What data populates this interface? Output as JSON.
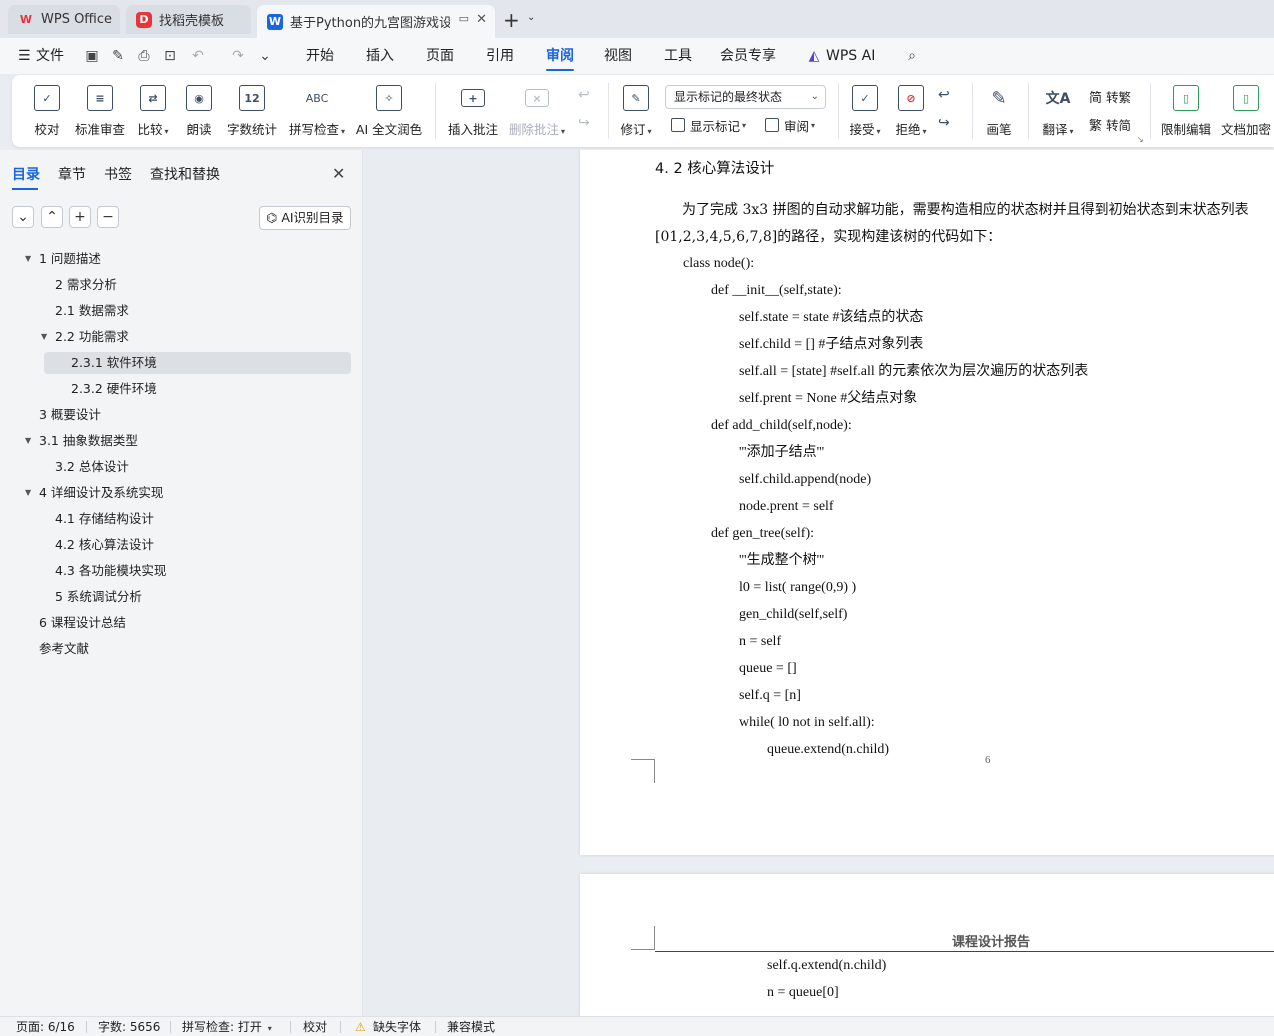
{
  "tabs": [
    {
      "label": "WPS Office",
      "logo": "W"
    },
    {
      "label": "找稻壳模板",
      "logo": "D"
    },
    {
      "label": "基于Python的九宫图游戏设计",
      "logo": "W"
    }
  ],
  "menu": {
    "file": "文件",
    "items": [
      "开始",
      "插入",
      "页面",
      "引用",
      "审阅",
      "视图",
      "工具",
      "会员专享"
    ],
    "active": "审阅",
    "wps_ai": "WPS AI"
  },
  "ribbon": {
    "proofread": "校对",
    "standard_review": "标准审查",
    "compare": "比较",
    "read_aloud": "朗读",
    "word_count": "字数统计",
    "spell_check": "拼写检查",
    "ai_polish": "AI 全文润色",
    "insert_comment": "插入批注",
    "delete_comment": "删除批注",
    "revise": "修订",
    "display_select": "显示标记的最终状态",
    "show_markup": "显示标记",
    "review": "审阅",
    "accept": "接受",
    "reject": "拒绝",
    "pen": "画笔",
    "translate": "翻译",
    "to_traditional": "转繁",
    "to_simplified": "转简",
    "restrict_edit": "限制编辑",
    "doc_encrypt": "文档加密",
    "icons": {
      "abc": "ABC",
      "twelve": "12"
    }
  },
  "nav": {
    "tabs": [
      "目录",
      "章节",
      "书签",
      "查找和替换"
    ],
    "active_tab": "目录",
    "ai_button": "AI识别目录",
    "toc": [
      {
        "label": "1  问题描述",
        "level": 0,
        "arrow": true
      },
      {
        "label": "2  需求分析",
        "level": 1,
        "arrow": false
      },
      {
        "label": "2.1  数据需求",
        "level": 1,
        "arrow": false
      },
      {
        "label": "2.2  功能需求",
        "level": 1,
        "arrow": true
      },
      {
        "label": "2.3.1 软件环境",
        "level": 2,
        "arrow": false,
        "selected": true
      },
      {
        "label": "2.3.2 硬件环境",
        "level": 2,
        "arrow": false
      },
      {
        "label": "3  概要设计",
        "level": 0,
        "arrow": false
      },
      {
        "label": "3.1 抽象数据类型",
        "level": 0,
        "arrow": true
      },
      {
        "label": "3.2  总体设计",
        "level": 1,
        "arrow": false
      },
      {
        "label": "4  详细设计及系统实现",
        "level": 0,
        "arrow": true
      },
      {
        "label": "4.1  存储结构设计",
        "level": 1,
        "arrow": false
      },
      {
        "label": "4.2  核心算法设计",
        "level": 1,
        "arrow": false
      },
      {
        "label": "4.3  各功能模块实现",
        "level": 1,
        "arrow": false
      },
      {
        "label": "5  系统调试分析",
        "level": 1,
        "arrow": false
      },
      {
        "label": "6  课程设计总结",
        "level": 0,
        "arrow": false
      },
      {
        "label": "参考文献",
        "level": 0,
        "arrow": false
      }
    ]
  },
  "document": {
    "heading": "4. 2  核心算法设计",
    "para1": "为了完成 3x3 拼图的自动求解功能，需要构造相应的状态树并且得到初始状态到末状态列表",
    "para2": "[01,2,3,4,5,6,7,8]的路径，实现构建该树的代码如下：",
    "code": [
      {
        "indent": 0,
        "text": "class node():"
      },
      {
        "indent": 1,
        "text": "def __init__(self,state):"
      },
      {
        "indent": 2,
        "text": "self.state = state    #该结点的状态"
      },
      {
        "indent": 2,
        "text": "self.child = []         #子结点对象列表"
      },
      {
        "indent": 2,
        "text": "self.all = [state]      #self.all 的元素依次为层次遍历的状态列表"
      },
      {
        "indent": 2,
        "text": "self.prent = None      #父结点对象"
      },
      {
        "indent": 1,
        "text": "def add_child(self,node):"
      },
      {
        "indent": 2,
        "text": "'''添加子结点'''"
      },
      {
        "indent": 2,
        "text": "self.child.append(node)"
      },
      {
        "indent": 2,
        "text": "node.prent = self"
      },
      {
        "indent": 1,
        "text": "def gen_tree(self):"
      },
      {
        "indent": 2,
        "text": "'''生成整个树'''"
      },
      {
        "indent": 2,
        "text": "l0 = list( range(0,9) )"
      },
      {
        "indent": 2,
        "text": "gen_child(self,self)"
      },
      {
        "indent": 2,
        "text": "n = self"
      },
      {
        "indent": 2,
        "text": "queue = []"
      },
      {
        "indent": 2,
        "text": "self.q = [n]"
      },
      {
        "indent": 2,
        "text": "while( l0 not in self.all):"
      },
      {
        "indent": 3,
        "text": "queue.extend(n.child)"
      }
    ],
    "page_number": "6",
    "page2_header": "课程设计报告",
    "page2_code": [
      {
        "indent": 3,
        "text": "self.q.extend(n.child)"
      },
      {
        "indent": 3,
        "text": "n = queue[0]"
      }
    ]
  },
  "status": {
    "page": "页面: 6/16",
    "words": "字数: 5656",
    "spell": "拼写检查: 打开",
    "proof": "校对",
    "missing_font": "缺失字体",
    "compat": "兼容模式"
  },
  "colors": {
    "accent": "#1a66e0",
    "wps_red": "#e8343a"
  }
}
